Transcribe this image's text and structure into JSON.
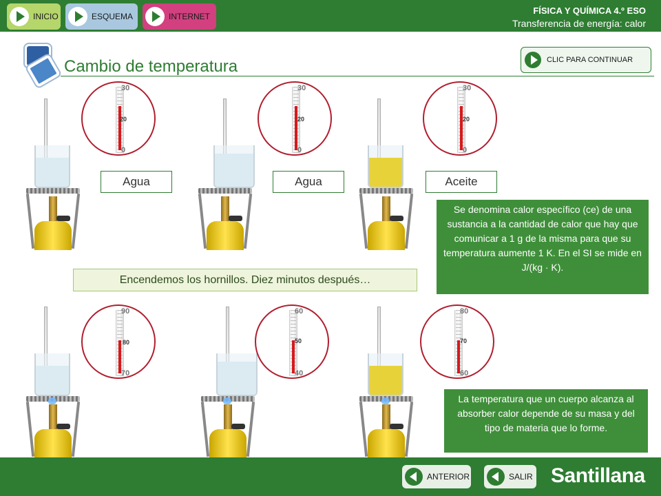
{
  "header": {
    "nav": [
      {
        "label": "INICIO"
      },
      {
        "label": "ESQUEMA"
      },
      {
        "label": "INTERNET"
      }
    ],
    "course": "FÍSICA Y QUÍMICA 4.º ESO",
    "unit": "Transferencia de energía: calor"
  },
  "title": "Cambio de temperatura",
  "continue_label": "CLIC PARA CONTINUAR",
  "before": {
    "gauges": [
      {
        "scale_top": "30",
        "scale_bottom": "0",
        "reading": "20",
        "level": 0.67
      },
      {
        "scale_top": "30",
        "scale_bottom": "0",
        "reading": "20",
        "level": 0.67
      },
      {
        "scale_top": "30",
        "scale_bottom": "0",
        "reading": "20",
        "level": 0.67
      }
    ],
    "labels": [
      "Agua",
      "Agua",
      "Aceite"
    ]
  },
  "after": {
    "gauges": [
      {
        "scale_top": "90",
        "scale_bottom": "70",
        "reading": "80",
        "level": 0.5
      },
      {
        "scale_top": "60",
        "scale_bottom": "40",
        "reading": "50",
        "level": 0.5
      },
      {
        "scale_top": "80",
        "scale_bottom": "60",
        "reading": "70",
        "level": 0.5
      }
    ]
  },
  "caption": "Encendemos los hornillos. Diez minutos después…",
  "info1": "Se denomina calor específico (ce) de una sustancia a la cantidad de calor que hay que comunicar a 1 g de la misma para que su temperatura aumente 1 K. En el SI se mide en J/(kg · K).",
  "info2": "La temperatura que un cuerpo alcanza al absorber calor depende de su masa y del tipo de materia que lo forme.",
  "footer": {
    "anterior": "ANTERIOR",
    "salir": "SALIR",
    "brand": "Santillana"
  },
  "colors": {
    "primary": "#2e7d32",
    "water": "#dcebf2",
    "oil": "#e8d23a",
    "mercury": "#d7191c"
  }
}
